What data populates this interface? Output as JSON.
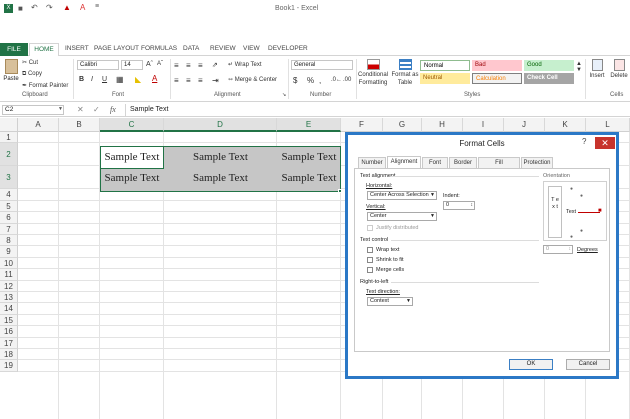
{
  "window": {
    "title": "Book1 - Excel"
  },
  "ribbon_tabs": [
    "FILE",
    "HOME",
    "INSERT",
    "PAGE LAYOUT",
    "FORMULAS",
    "DATA",
    "REVIEW",
    "VIEW",
    "DEVELOPER"
  ],
  "clipboard": {
    "paste": "Paste",
    "cut": "Cut",
    "copy": "Copy",
    "format_painter": "Format Painter",
    "label": "Clipboard"
  },
  "font": {
    "name": "Calibri",
    "size": "14",
    "bold": "B",
    "italic": "I",
    "underline": "U",
    "label": "Font"
  },
  "alignment": {
    "wrap_text": "Wrap Text",
    "merge_center": "Merge & Center",
    "label": "Alignment"
  },
  "number": {
    "format": "General",
    "currency": "$",
    "percent": "%",
    "comma": ",",
    "label": "Number"
  },
  "styles": {
    "conditional": "Conditional Formatting",
    "format_as_table": "Format as Table",
    "cells": [
      {
        "name": "Normal",
        "bg": "#ffffff",
        "fg": "#000000"
      },
      {
        "name": "Bad",
        "bg": "#ffc7ce",
        "fg": "#9c0006"
      },
      {
        "name": "Good",
        "bg": "#c6efce",
        "fg": "#006100"
      },
      {
        "name": "Neutral",
        "bg": "#ffeb9c",
        "fg": "#9c5700"
      },
      {
        "name": "Calculation",
        "bg": "#f2f2f2",
        "fg": "#fa7d00"
      },
      {
        "name": "Check Cell",
        "bg": "#a5a5a5",
        "fg": "#ffffff"
      }
    ],
    "label": "Styles"
  },
  "cells_group": {
    "insert": "Insert",
    "delete": "Delete",
    "label": "Cells"
  },
  "formula_bar": {
    "name_box": "C2",
    "fx": "fx",
    "cancel": "✕",
    "enter": "✓",
    "value": "Sample Text"
  },
  "columns": [
    "A",
    "B",
    "C",
    "D",
    "E",
    "F",
    "G",
    "H",
    "I",
    "J",
    "K",
    "L"
  ],
  "rows": [
    "1",
    "2",
    "3",
    "4",
    "5",
    "6",
    "7",
    "8",
    "9",
    "10",
    "11",
    "12",
    "13",
    "14",
    "15",
    "16",
    "17",
    "18",
    "19"
  ],
  "sheet_cells": [
    {
      "ref": "C2",
      "value": "Sample Text"
    },
    {
      "ref": "D2",
      "value": "Sample Text"
    },
    {
      "ref": "E2",
      "value": "Sample Text"
    },
    {
      "ref": "C3",
      "value": "Sample Text"
    },
    {
      "ref": "D3",
      "value": "Sample Text"
    },
    {
      "ref": "E3",
      "value": "Sample Text"
    }
  ],
  "dialog": {
    "title": "Format Cells",
    "help": "?",
    "close": "✕",
    "tabs": [
      "Number",
      "Alignment",
      "Font",
      "Border",
      "Fill",
      "Protection"
    ],
    "active_tab": "Alignment",
    "text_alignment": "Text alignment",
    "horizontal_label": "Horizontal:",
    "horizontal_value": "Center Across Selection",
    "indent_label": "Indent:",
    "indent_value": "0",
    "vertical_label": "Vertical:",
    "vertical_value": "Center",
    "justify_distributed": "Justify distributed",
    "text_control": "Text control",
    "wrap_text": "Wrap text",
    "shrink_to_fit": "Shrink to fit",
    "merge_cells": "Merge cells",
    "right_to_left": "Right-to-left",
    "text_direction_label": "Text direction:",
    "text_direction_value": "Context",
    "orientation": "Orientation",
    "orientation_vertical_text": "T e x t",
    "orientation_text": "Text",
    "degrees_value": "0",
    "degrees_label": "Degrees",
    "ok": "OK",
    "cancel": "Cancel"
  },
  "colors": {
    "excel_green": "#217346",
    "selection_fill": "#c6c6c6",
    "dialog_border": "#2b78c6",
    "close_red": "#c7332c"
  }
}
